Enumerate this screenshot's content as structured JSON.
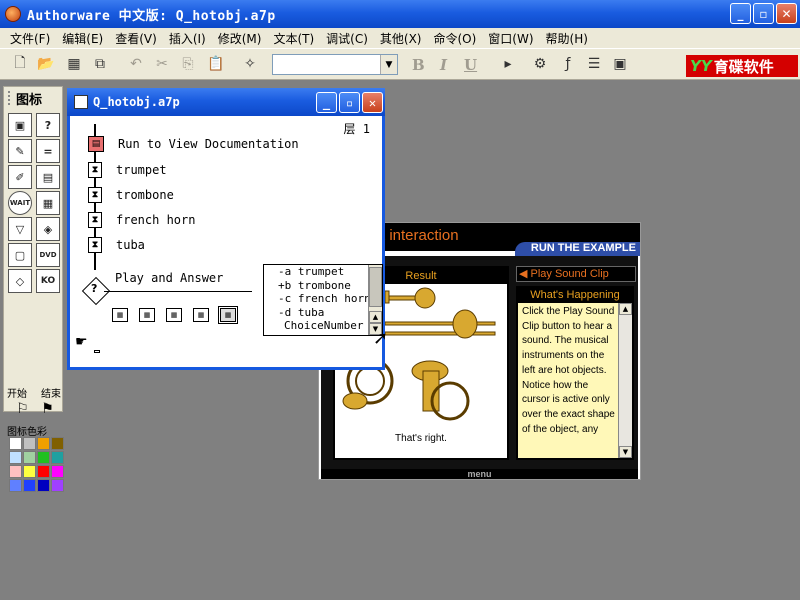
{
  "app": {
    "title": "Authorware 中文版: Q_hotobj.a7p",
    "min_label": "_",
    "max_label": "▫",
    "close_label": "✕"
  },
  "menu": {
    "items": [
      "文件(F)",
      "编辑(E)",
      "查看(V)",
      "插入(I)",
      "修改(M)",
      "文本(T)",
      "调试(C)",
      "其他(X)",
      "命令(O)",
      "窗口(W)",
      "帮助(H)"
    ]
  },
  "toolbar": {
    "font_combo_value": "",
    "bold_label": "B",
    "italic_label": "I",
    "underline_label": "U",
    "logo_text": "育碟软件",
    "logo_mark": "YY"
  },
  "palette": {
    "title": "图标",
    "icons": [
      {
        "name": "display-icon",
        "glyph": "▣"
      },
      {
        "name": "motion-icon",
        "glyph": "?"
      },
      {
        "name": "erase-icon",
        "glyph": "✎"
      },
      {
        "name": "wait-icon",
        "glyph": "="
      },
      {
        "name": "navigate-icon",
        "glyph": "✐"
      },
      {
        "name": "framework-icon",
        "glyph": "▤"
      },
      {
        "name": "decision-icon",
        "glyph": "WAIT"
      },
      {
        "name": "interaction-icon",
        "glyph": "▦"
      },
      {
        "name": "calculation-icon",
        "glyph": "▽"
      },
      {
        "name": "map-icon",
        "glyph": "◈"
      },
      {
        "name": "digital-movie-icon",
        "glyph": "▢"
      },
      {
        "name": "sound-icon",
        "glyph": "DVD"
      },
      {
        "name": "video-icon",
        "glyph": "◇"
      },
      {
        "name": "knowledge-object-icon",
        "glyph": "KO"
      }
    ],
    "start_label": "开始",
    "end_label": "结束",
    "color_label": "图标色彩",
    "swatches": [
      "#ffffff",
      "#c0c0c0",
      "#f0a000",
      "#806000",
      "#c0e0ff",
      "#a0d0a0",
      "#20c020",
      "#20a0a0",
      "#ffc0c0",
      "#ffff40",
      "#ff0000",
      "#ff00ff",
      "#6080ff",
      "#2040ff",
      "#0000c0",
      "#a040ff"
    ]
  },
  "presentation": {
    "header_text": "t interaction",
    "tab_text": "RUN THE EXAMPLE",
    "result_label": "Result",
    "result_caption": "That's right.",
    "play_button": "◀ Play Sound Clip",
    "happening_label": "What's Happening",
    "happening_text": "Click the Play Sound Clip button to hear a sound. The musical instruments on the left are hot objects. Notice how the cursor is active only over the exact shape of the object, any",
    "menu_label": "menu"
  },
  "flow_window": {
    "title": "Q_hotobj.a7p",
    "level_text": "层 1",
    "items": [
      {
        "label": "Run to View Documentation"
      },
      {
        "label": "trumpet"
      },
      {
        "label": "trombone"
      },
      {
        "label": "french horn"
      },
      {
        "label": "tuba"
      }
    ],
    "interaction_label": "Play and Answer",
    "responses": [
      "-a trumpet",
      "+b trombone",
      "-c french horn",
      "-d tuba",
      "ChoiceNumber"
    ]
  }
}
